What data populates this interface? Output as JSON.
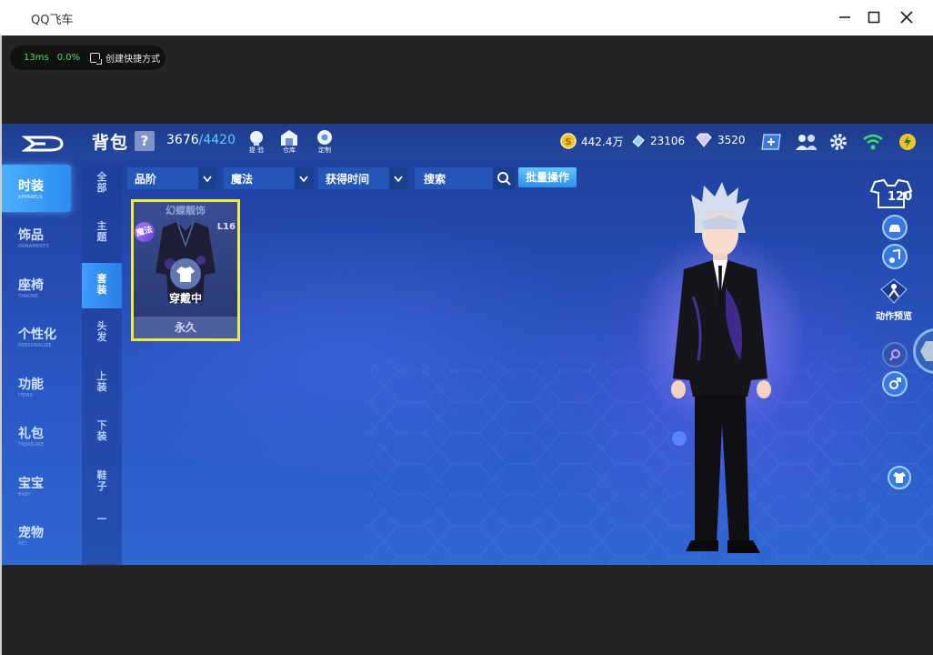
{
  "window": {
    "title": "QQ飞车"
  },
  "perf": {
    "ms": "13ms",
    "loss": "0.0%",
    "shortcut": "创建快捷方式"
  },
  "header": {
    "title": "背包",
    "help": "?",
    "capacity_used": "3676",
    "capacity_max": "/4420",
    "icons": [
      {
        "name": "prompt",
        "label": "提 验"
      },
      {
        "name": "warehouse",
        "label": "仓库"
      },
      {
        "name": "custom",
        "label": "定制"
      }
    ],
    "coins": "442.4万",
    "coupons": "23106",
    "diamonds": "3520"
  },
  "leftnav": [
    {
      "zh": "时装",
      "en": "APPARELS",
      "active": true
    },
    {
      "zh": "饰品",
      "en": "ORNAMENTS"
    },
    {
      "zh": "座椅",
      "en": "THRONE"
    },
    {
      "zh": "个性化",
      "en": "PERSONALIZE"
    },
    {
      "zh": "功能",
      "en": "ITEMS"
    },
    {
      "zh": "礼包",
      "en": "TREASURE"
    },
    {
      "zh": "宝宝",
      "en": "BABY"
    },
    {
      "zh": "宠物",
      "en": "PET"
    }
  ],
  "subnav": [
    {
      "t": "全部"
    },
    {
      "t": "主题"
    },
    {
      "t": "套装",
      "active": true
    },
    {
      "t": "头发"
    },
    {
      "t": "上装"
    },
    {
      "t": "下装"
    },
    {
      "t": "鞋子"
    }
  ],
  "filters": {
    "grade": "品阶",
    "type": "魔法",
    "sort": "获得时间",
    "search": "搜索",
    "batch": "批量操作"
  },
  "item": {
    "name": "幻蝶靓饰",
    "badge": "魔法",
    "level": "L16",
    "status": "穿戴中",
    "duration": "永久"
  },
  "character": {
    "level": "120",
    "action_preview": "动作预览"
  },
  "colors": {
    "accent": "#2c8cf0",
    "card_border": "#f4ec3d",
    "topbar": "#1d3d8c"
  }
}
